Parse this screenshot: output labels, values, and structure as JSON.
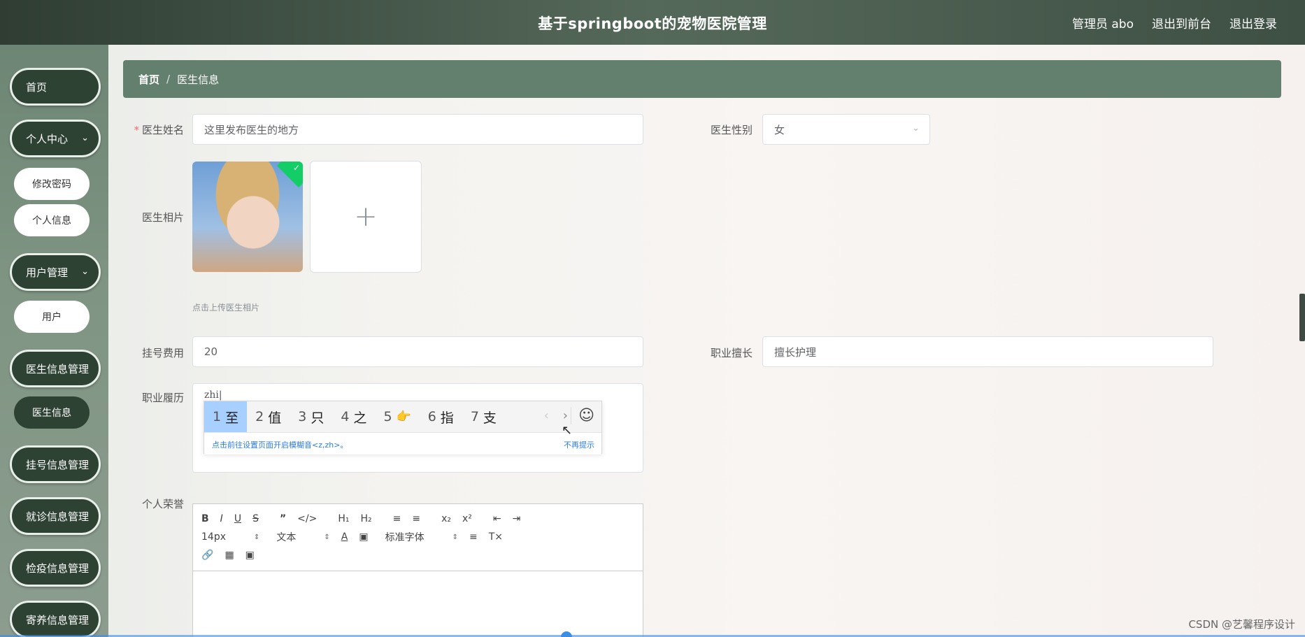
{
  "header": {
    "title": "基于springboot的宠物医院管理",
    "user": "管理员 abo",
    "front_link": "退出到前台",
    "logout_link": "退出登录"
  },
  "sidebar": {
    "home": "首页",
    "personal_center": "个人中心",
    "change_password": "修改密码",
    "personal_info": "个人信息",
    "user_mgmt": "用户管理",
    "user": "用户",
    "doctor_mgmt": "医生信息管理",
    "doctor_info": "医生信息",
    "register_mgmt": "挂号信息管理",
    "visit_mgmt": "就诊信息管理",
    "quarantine_mgmt": "检疫信息管理",
    "boarding_mgmt": "寄养信息管理"
  },
  "breadcrumb": {
    "home": "首页",
    "sep": "/",
    "current": "医生信息"
  },
  "form": {
    "name_label": "医生姓名",
    "name_value": "这里发布医生的地方",
    "gender_label": "医生性别",
    "gender_value": "女",
    "photo_label": "医生相片",
    "photo_hint": "点击上传医生相片",
    "fee_label": "挂号费用",
    "fee_value": "20",
    "specialty_label": "职业擅长",
    "specialty_value": "擅长护理",
    "resume_label": "职业履历",
    "resume_value": "zhi|",
    "honor_label": "个人荣誉"
  },
  "ime": {
    "candidates": [
      {
        "num": "1",
        "text": "至"
      },
      {
        "num": "2",
        "text": "值"
      },
      {
        "num": "3",
        "text": "只"
      },
      {
        "num": "4",
        "text": "之"
      },
      {
        "num": "5",
        "text": "👉"
      },
      {
        "num": "6",
        "text": "指"
      },
      {
        "num": "7",
        "text": "支"
      }
    ],
    "tip": "点击前往设置页面开启模糊音<z,zh>。",
    "dismiss": "不再提示"
  },
  "editor": {
    "font_size": "14px",
    "block_type": "文本",
    "font_family": "标准字体"
  },
  "watermark": "CSDN @艺馨程序设计"
}
